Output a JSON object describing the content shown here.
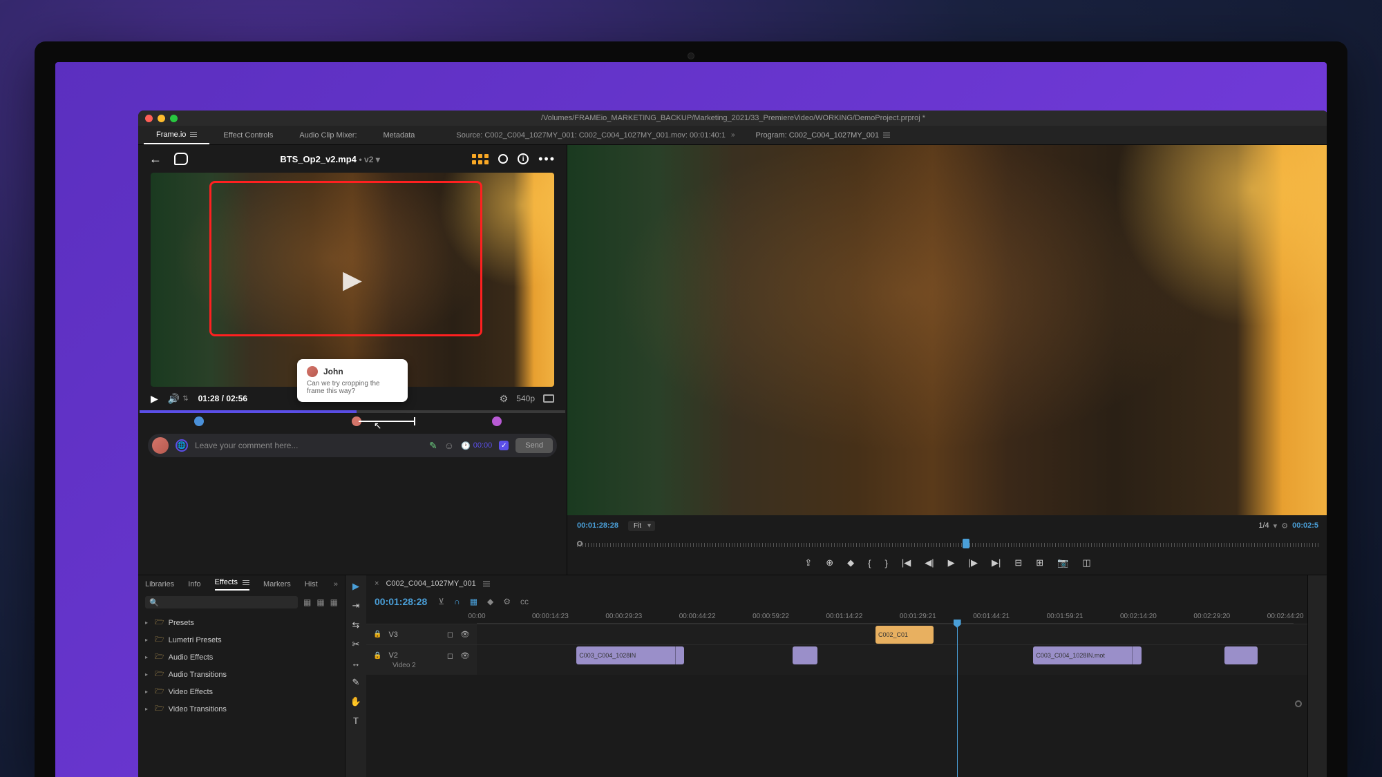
{
  "window": {
    "path": "/Volumes/FRAMEio_MARKETING_BACKUP/Marketing_2021/33_PremiereVideo/WORKING/DemoProject.prproj *"
  },
  "tabs": {
    "items": [
      "Frame.io",
      "Effect Controls",
      "Audio Clip Mixer:",
      "Metadata"
    ],
    "source_label": "Source: C002_C004_1027MY_001: C002_C004_1027MY_001.mov: 00:01:40:1"
  },
  "frameio": {
    "filename": "BTS_Op2_v2.mp4",
    "version": "• v2 ▾",
    "current_time": "01:28",
    "total_time": "02:56",
    "resolution": "540p",
    "tooltip": {
      "author": "John",
      "text": "Can we try cropping the frame this way?"
    },
    "comment": {
      "placeholder": "Leave your comment here...",
      "timecode": "00:00",
      "send": "Send"
    }
  },
  "program": {
    "label": "Program: C002_C004_1027MY_001",
    "timecode": "00:01:28:28",
    "fit": "Fit",
    "fraction": "1/4",
    "endtc": "00:02:5"
  },
  "effects": {
    "tabs": [
      "Libraries",
      "Info",
      "Effects",
      "Markers",
      "Hist"
    ],
    "tree": [
      "Presets",
      "Lumetri Presets",
      "Audio Effects",
      "Audio Transitions",
      "Video Effects",
      "Video Transitions"
    ]
  },
  "timeline": {
    "seq_name": "C002_C004_1027MY_001",
    "timecode": "00:01:28:28",
    "ruler": [
      "00:00",
      "00:00:14:23",
      "00:00:29:23",
      "00:00:44:22",
      "00:00:59:22",
      "00:01:14:22",
      "00:01:29:21",
      "00:01:44:21",
      "00:01:59:21",
      "00:02:14:20",
      "00:02:29:20",
      "00:02:44:20"
    ],
    "track_v3": "V3",
    "track_v2": "V2",
    "track_v2_name": "Video 2",
    "clip_org": "C002_C01",
    "clip_pur1": "C003_C004_1028IN",
    "clip_pur2": "C003_C004_1028IN.mot"
  }
}
